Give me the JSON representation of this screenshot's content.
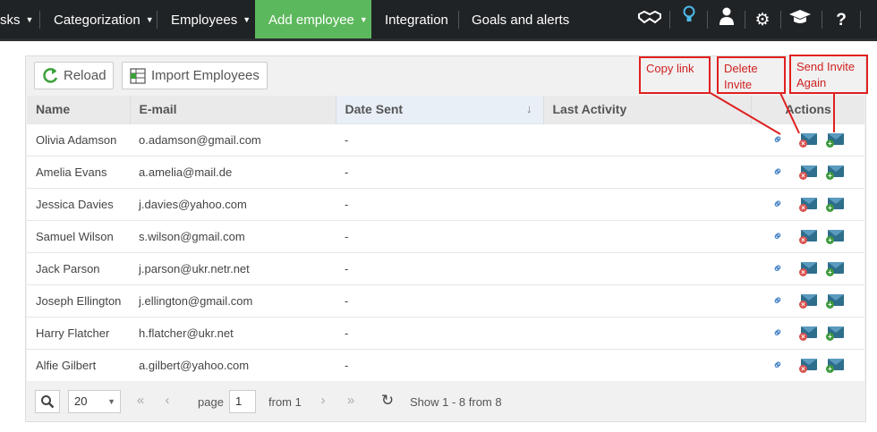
{
  "nav": {
    "items": [
      {
        "label": "sks",
        "has_chevron": true
      },
      {
        "label": "Categorization",
        "has_chevron": true
      },
      {
        "label": "Employees",
        "has_chevron": true
      },
      {
        "label": "Add employee",
        "has_chevron": true,
        "active": true
      },
      {
        "label": "Integration",
        "has_chevron": false
      },
      {
        "label": "Goals and alerts",
        "has_chevron": false
      }
    ],
    "icons": [
      "handshake-icon",
      "lightbulb-icon",
      "user-icon",
      "gear-icon",
      "graduation-cap-icon",
      "help-icon"
    ],
    "active_color": "#5cb85c"
  },
  "toolbar": {
    "reload_label": "Reload",
    "import_label": "Import Employees"
  },
  "table": {
    "columns": [
      "Name",
      "E-mail",
      "Date Sent",
      "Last Activity",
      "Actions"
    ],
    "rows": [
      {
        "name": "Olivia Adamson",
        "email": "o.adamson@gmail.com",
        "date_sent": "-",
        "last_activity": ""
      },
      {
        "name": "Amelia Evans",
        "email": "a.amelia@mail.de",
        "date_sent": "-",
        "last_activity": ""
      },
      {
        "name": "Jessica Davies",
        "email": "j.davies@yahoo.com",
        "date_sent": "-",
        "last_activity": ""
      },
      {
        "name": "Samuel Wilson",
        "email": "s.wilson@gmail.com",
        "date_sent": "-",
        "last_activity": ""
      },
      {
        "name": "Jack Parson",
        "email": "j.parson@ukr.netr.net",
        "date_sent": "-",
        "last_activity": ""
      },
      {
        "name": "Joseph Ellington",
        "email": "j.ellington@gmail.com",
        "date_sent": "-",
        "last_activity": ""
      },
      {
        "name": "Harry Flatcher",
        "email": "h.flatcher@ukr.net",
        "date_sent": "-",
        "last_activity": ""
      },
      {
        "name": "Alfie Gilbert",
        "email": "a.gilbert@yahoo.com",
        "date_sent": "-",
        "last_activity": ""
      }
    ]
  },
  "pager": {
    "page_size": "20",
    "page_label": "page",
    "page_value": "1",
    "from_label": "from 1",
    "show_text": "Show 1 - 8 from 8"
  },
  "annotations": {
    "copy_link": "Copy link",
    "delete_invite": "Delete Invite",
    "send_again": "Send Invite Again",
    "color": "#e02020"
  }
}
